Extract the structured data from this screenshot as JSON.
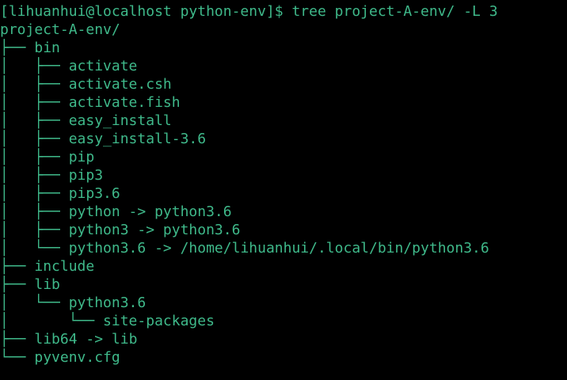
{
  "terminal": {
    "prompt": "[lihuanhui@localhost python-env]$ tree project-A-env/ -L 3",
    "root": "project-A-env/",
    "entries": [
      {
        "prefix": "├── ",
        "name": "bin"
      },
      {
        "prefix": "│   ├── ",
        "name": "activate"
      },
      {
        "prefix": "│   ├── ",
        "name": "activate.csh"
      },
      {
        "prefix": "│   ├── ",
        "name": "activate.fish"
      },
      {
        "prefix": "│   ├── ",
        "name": "easy_install"
      },
      {
        "prefix": "│   ├── ",
        "name": "easy_install-3.6"
      },
      {
        "prefix": "│   ├── ",
        "name": "pip"
      },
      {
        "prefix": "│   ├── ",
        "name": "pip3"
      },
      {
        "prefix": "│   ├── ",
        "name": "pip3.6"
      },
      {
        "prefix": "│   ├── ",
        "name": "python -> python3.6"
      },
      {
        "prefix": "│   ├── ",
        "name": "python3 -> python3.6"
      },
      {
        "prefix": "│   └── ",
        "name": "python3.6 -> /home/lihuanhui/.local/bin/python3.6"
      },
      {
        "prefix": "├── ",
        "name": "include"
      },
      {
        "prefix": "├── ",
        "name": "lib"
      },
      {
        "prefix": "│   └── ",
        "name": "python3.6"
      },
      {
        "prefix": "│       └── ",
        "name": "site-packages"
      },
      {
        "prefix": "├── ",
        "name": "lib64 -> lib"
      },
      {
        "prefix": "└── ",
        "name": "pyvenv.cfg"
      }
    ]
  }
}
